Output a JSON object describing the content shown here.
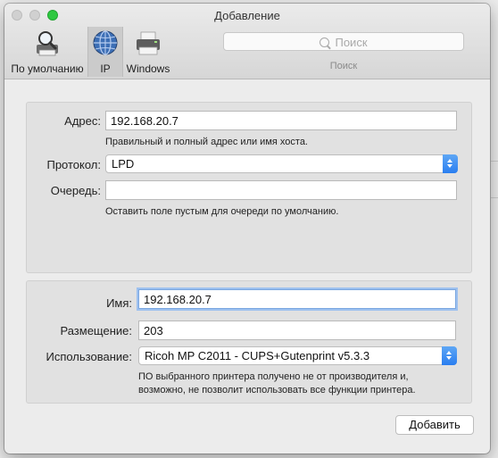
{
  "window": {
    "title": "Добавление"
  },
  "toolbar": {
    "tabs": [
      {
        "label": "По умолчанию",
        "icon": "magnifier-printer-icon"
      },
      {
        "label": "IP",
        "icon": "globe-icon",
        "selected": true
      },
      {
        "label": "Windows",
        "icon": "windows-printer-icon"
      }
    ],
    "search": {
      "placeholder": "Поиск",
      "label": "Поиск"
    }
  },
  "connection": {
    "address_label": "Адрес:",
    "address_value": "192.168.20.7",
    "address_hint": "Правильный и полный адрес или имя хоста.",
    "protocol_label": "Протокол:",
    "protocol_value": "LPD",
    "queue_label": "Очередь:",
    "queue_value": "",
    "queue_hint": "Оставить поле пустым для очереди по умолчанию."
  },
  "printer": {
    "name_label": "Имя:",
    "name_value": "192.168.20.7",
    "location_label": "Размещение:",
    "location_value": "203",
    "use_label": "Использование:",
    "use_value": "Ricoh MP C2011 - CUPS+Gutenprint v5.3.3",
    "use_hint_line1": "ПО выбранного принтера получено не от производителя и,",
    "use_hint_line2": "возможно, не позволит использовать все функции принтера."
  },
  "actions": {
    "add_label": "Добавить"
  },
  "colors": {
    "accent": "#2a7ef0",
    "focus_ring": "#9ec1ef"
  }
}
